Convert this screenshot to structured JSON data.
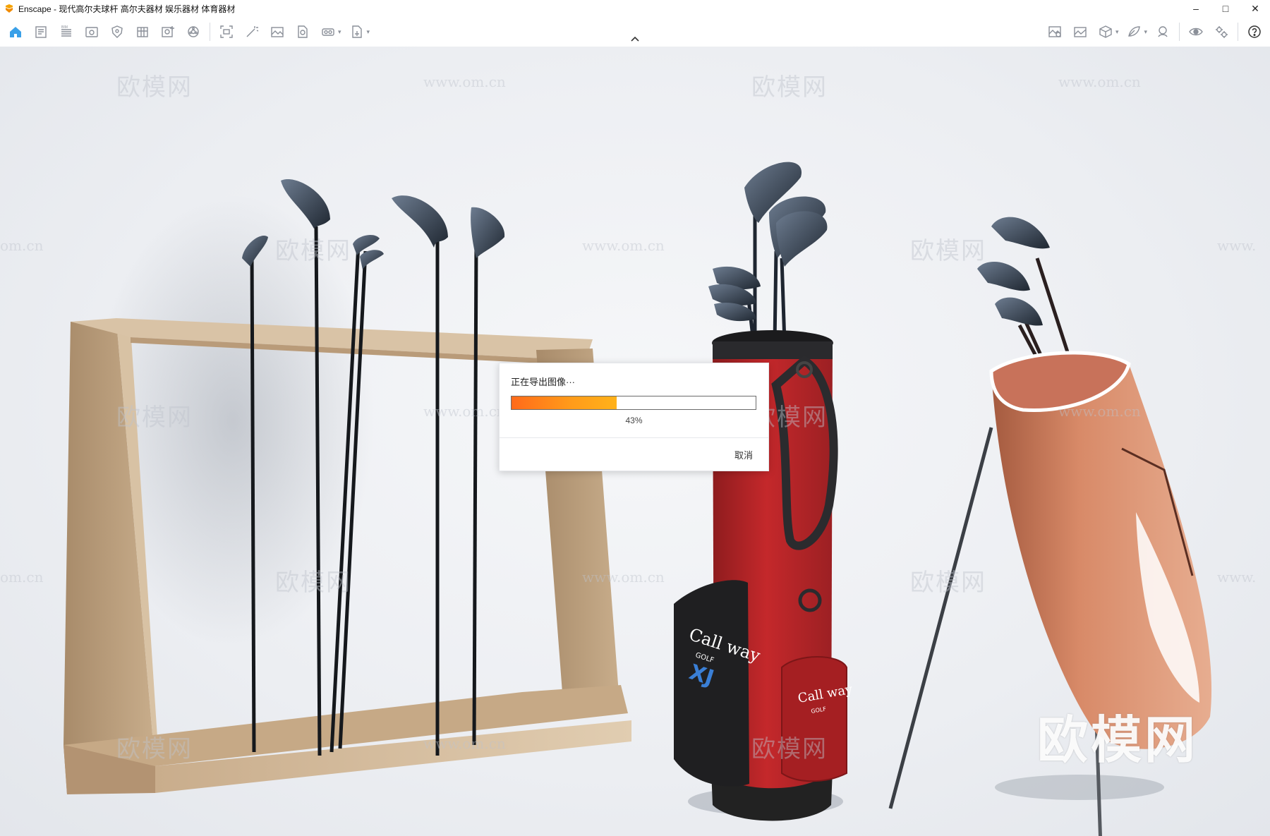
{
  "window": {
    "title": "Enscape - 现代高尔夫球杆 高尔夫器材 娱乐器材 体育器材",
    "controls": {
      "minimize": "–",
      "maximize": "□",
      "close": "✕"
    },
    "logo_icon": "enscape-logo-icon"
  },
  "toolbar": {
    "left_icons": [
      "home-icon",
      "notes-icon",
      "bim-icon",
      "view-icon",
      "shield-icon",
      "building-icon",
      "add-view-icon",
      "settings-wheel-icon",
      "capture-icon",
      "magic-wand-icon",
      "image-icon",
      "batch-render-icon",
      "vr-headset-icon",
      "export-icon"
    ],
    "right_icons": [
      "map-view-icon",
      "gallery-icon",
      "asset-library-icon",
      "material-editor-icon",
      "vr-icon",
      "visibility-icon",
      "settings-icon",
      "help-icon"
    ],
    "collapse_icon": "chevron-up-icon"
  },
  "watermarks": {
    "brand": "欧模网",
    "url": "www.om.cn",
    "url_partial_left": "om.cn",
    "url_partial_right": "www."
  },
  "dialog": {
    "message": "正在导出图像···",
    "progress_percent": 43,
    "progress_label": "43%",
    "cancel_label": "取消"
  },
  "scene": {
    "bag_red_brand": "Call way",
    "bag_red_sub": "GOLF",
    "bag_red_model": "XJ",
    "bag_red_pocket_brand": "Call way",
    "bag_red_pocket_sub": "GOLF"
  }
}
